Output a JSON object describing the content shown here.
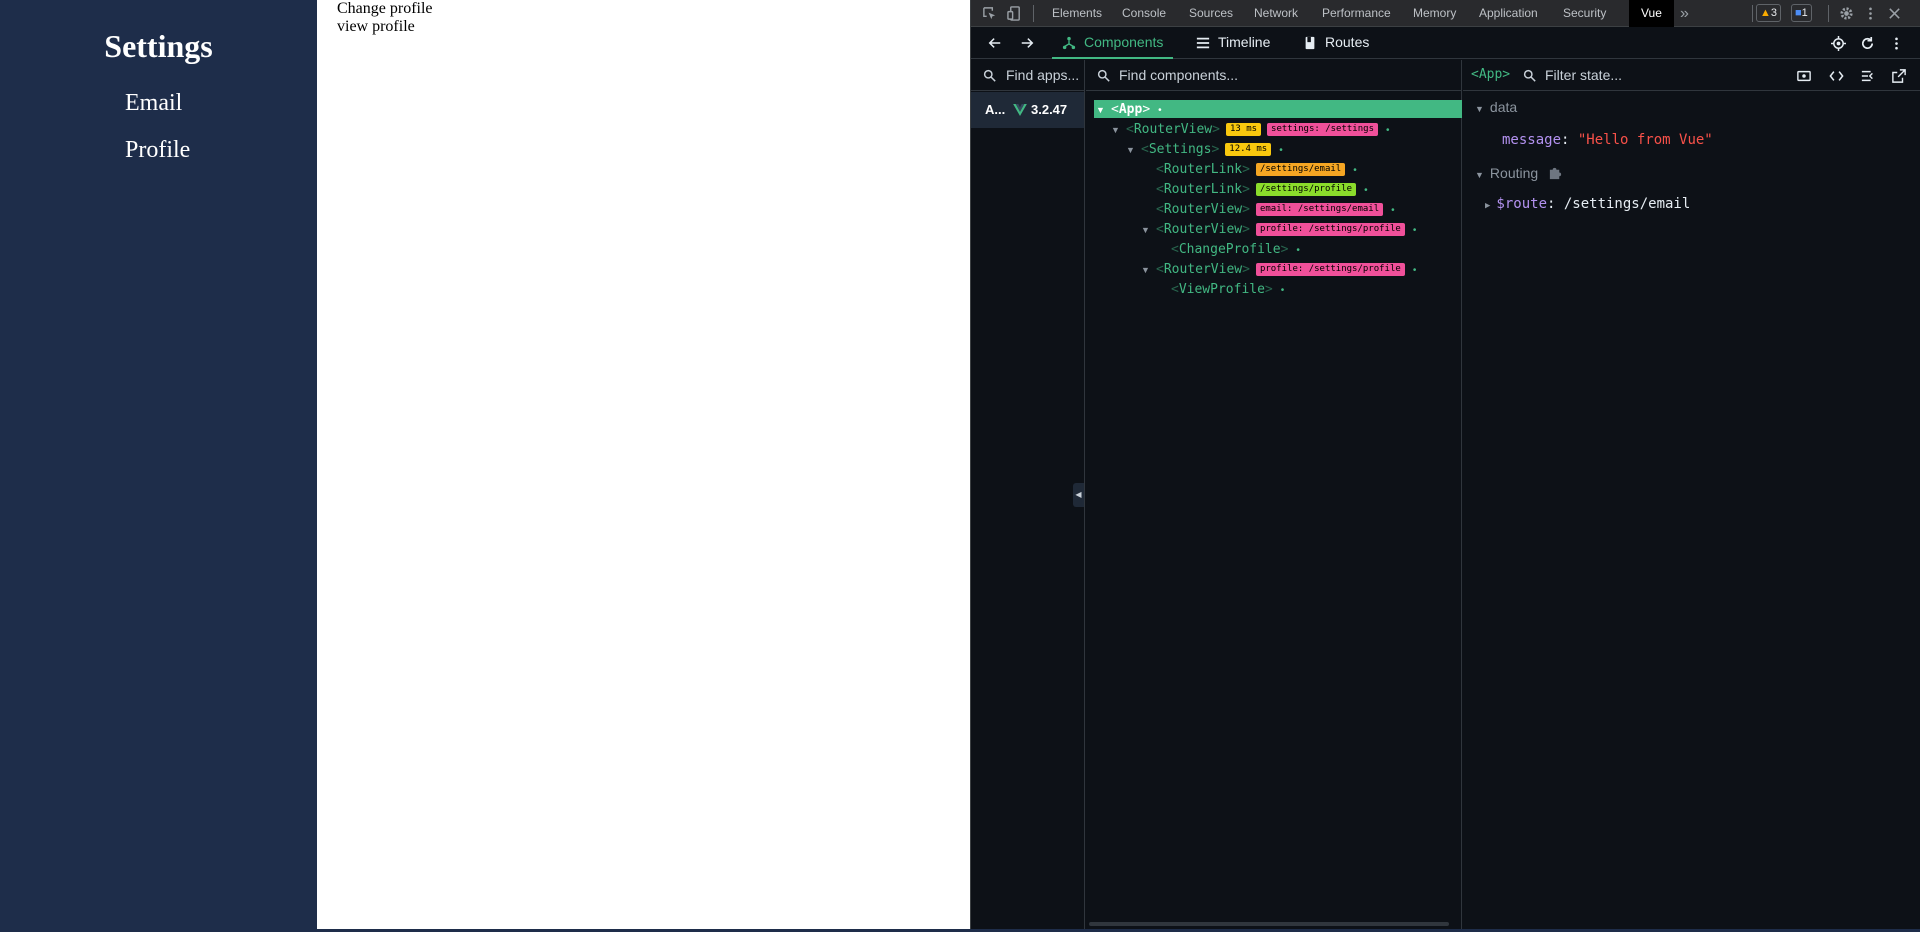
{
  "app": {
    "sidebar_title": "Settings",
    "nav": [
      "Email",
      "Profile"
    ],
    "content_lines": [
      "Change profile",
      "view profile"
    ]
  },
  "devtools": {
    "tabs": [
      "Elements",
      "Console",
      "Sources",
      "Network",
      "Performance",
      "Memory",
      "Application",
      "Security",
      "Vue"
    ],
    "active_tab": "Vue",
    "warnings_count": "3",
    "messages_count": "1",
    "colors": {
      "vue_green": "#42b883",
      "tag_yellow": "#f9c80e",
      "tag_orange": "#f5a623",
      "tag_pink": "#f0509a",
      "tag_lime": "#8bdc2b"
    }
  },
  "vue": {
    "toolbar_tabs": [
      "Components",
      "Timeline",
      "Routes"
    ],
    "active_toolbar_tab": "Components",
    "apps_search_placeholder": "Find apps...",
    "app_item_name": "A...",
    "app_item_version": "3.2.47",
    "components_search_placeholder": "Find components...",
    "tree": [
      {
        "name": "App",
        "depth": 0,
        "expanded": true,
        "selected": true,
        "tags": []
      },
      {
        "name": "RouterView",
        "depth": 1,
        "expanded": true,
        "tags": [
          {
            "text": "13 ms",
            "color": "#f9c80e"
          },
          {
            "text": "settings: /settings",
            "color": "#f0509a"
          }
        ]
      },
      {
        "name": "Settings",
        "depth": 2,
        "expanded": true,
        "tags": [
          {
            "text": "12.4 ms",
            "color": "#f9c80e"
          }
        ]
      },
      {
        "name": "RouterLink",
        "depth": 3,
        "expanded": false,
        "tags": [
          {
            "text": "/settings/email",
            "color": "#f5a623"
          }
        ]
      },
      {
        "name": "RouterLink",
        "depth": 3,
        "expanded": false,
        "tags": [
          {
            "text": "/settings/profile",
            "color": "#8bdc2b"
          }
        ]
      },
      {
        "name": "RouterView",
        "depth": 3,
        "expanded": false,
        "tags": [
          {
            "text": "email: /settings/email",
            "color": "#f0509a"
          }
        ]
      },
      {
        "name": "RouterView",
        "depth": 3,
        "expanded": true,
        "tags": [
          {
            "text": "profile: /settings/profile",
            "color": "#f0509a"
          }
        ]
      },
      {
        "name": "ChangeProfile",
        "depth": 4,
        "expanded": false,
        "tags": []
      },
      {
        "name": "RouterView",
        "depth": 3,
        "expanded": true,
        "tags": [
          {
            "text": "profile: /settings/profile",
            "color": "#f0509a"
          }
        ]
      },
      {
        "name": "ViewProfile",
        "depth": 4,
        "expanded": false,
        "tags": []
      }
    ],
    "state_header_component": "<App>",
    "state_filter_placeholder": "Filter state...",
    "sections": {
      "data_label": "data",
      "data_key": "message",
      "data_value": "\"Hello from Vue\"",
      "routing_label": "Routing",
      "route_key": "$route",
      "route_value": "/settings/email"
    }
  }
}
